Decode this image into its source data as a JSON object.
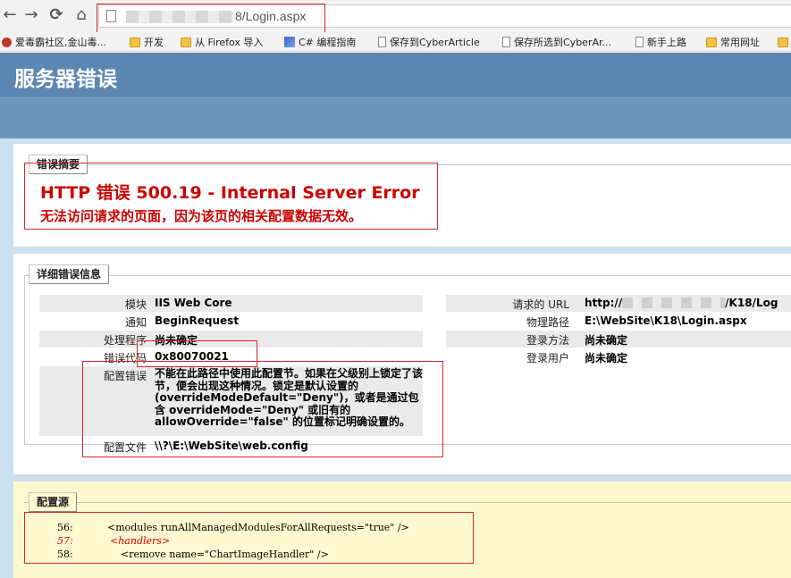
{
  "browser": {
    "url_visible": "8/Login.aspx",
    "bookmarks": [
      {
        "label": "爱毒霸社区,金山毒...",
        "icon": "favicon-icon"
      },
      {
        "label": "开发",
        "icon": "folder-icon"
      },
      {
        "label": "从 Firefox 导入",
        "icon": "folder-icon"
      },
      {
        "label": "C# 编程指南",
        "icon": "csharp-icon"
      },
      {
        "label": "保存到CyberArticle",
        "icon": "page-icon"
      },
      {
        "label": "保存所选到CyberAr...",
        "icon": "page-icon"
      },
      {
        "label": "新手上路",
        "icon": "page-icon"
      },
      {
        "label": "常用网址",
        "icon": "folder-icon"
      }
    ]
  },
  "page": {
    "header_title": "服务器错误",
    "summary": {
      "legend": "错误摘要",
      "title": "HTTP 错误 500.19 - Internal Server Error",
      "subtitle": "无法访问请求的页面，因为该页的相关配置数据无效。"
    },
    "detail": {
      "legend": "详细错误信息",
      "left": [
        {
          "label": "模块",
          "value": "IIS Web Core"
        },
        {
          "label": "通知",
          "value": "BeginRequest"
        },
        {
          "label": "处理程序",
          "value": "尚未确定"
        },
        {
          "label": "错误代码",
          "value": "0x80070021"
        },
        {
          "label": "配置错误",
          "value": "不能在此路径中使用此配置节。如果在父级别上锁定了该节，便会出现这种情况。锁定是默认设置的(overrideModeDefault=\"Deny\")，或者是通过包含 overrideMode=\"Deny\" 或旧有的 allowOverride=\"false\" 的位置标记明确设置的。"
        },
        {
          "label": "配置文件",
          "value": "\\\\?\\E:\\WebSite\\web.config"
        }
      ],
      "right": [
        {
          "label": "请求的 URL",
          "value_prefix": "http://",
          "value_suffix": "/K18/Log"
        },
        {
          "label": "物理路径",
          "value": "E:\\WebSite\\K18\\Login.aspx"
        },
        {
          "label": "登录方法",
          "value": "尚未确定"
        },
        {
          "label": "登录用户",
          "value": "尚未确定"
        }
      ]
    },
    "config_source": {
      "legend": "配置源",
      "lines": [
        {
          "num": "56:",
          "code": "<modules runAllManagedModulesForAllRequests=\"true\" />"
        },
        {
          "num": "57:",
          "code": "<handlers>"
        },
        {
          "num": "58:",
          "code": "<remove name=\"ChartImageHandler\" />"
        }
      ]
    }
  },
  "colors": {
    "header": "#5c87b2",
    "error_red": "#cc0000",
    "annotation_red": "#d9262a",
    "page_bg": "#cbe1ef",
    "source_bg": "#fff8d0"
  }
}
